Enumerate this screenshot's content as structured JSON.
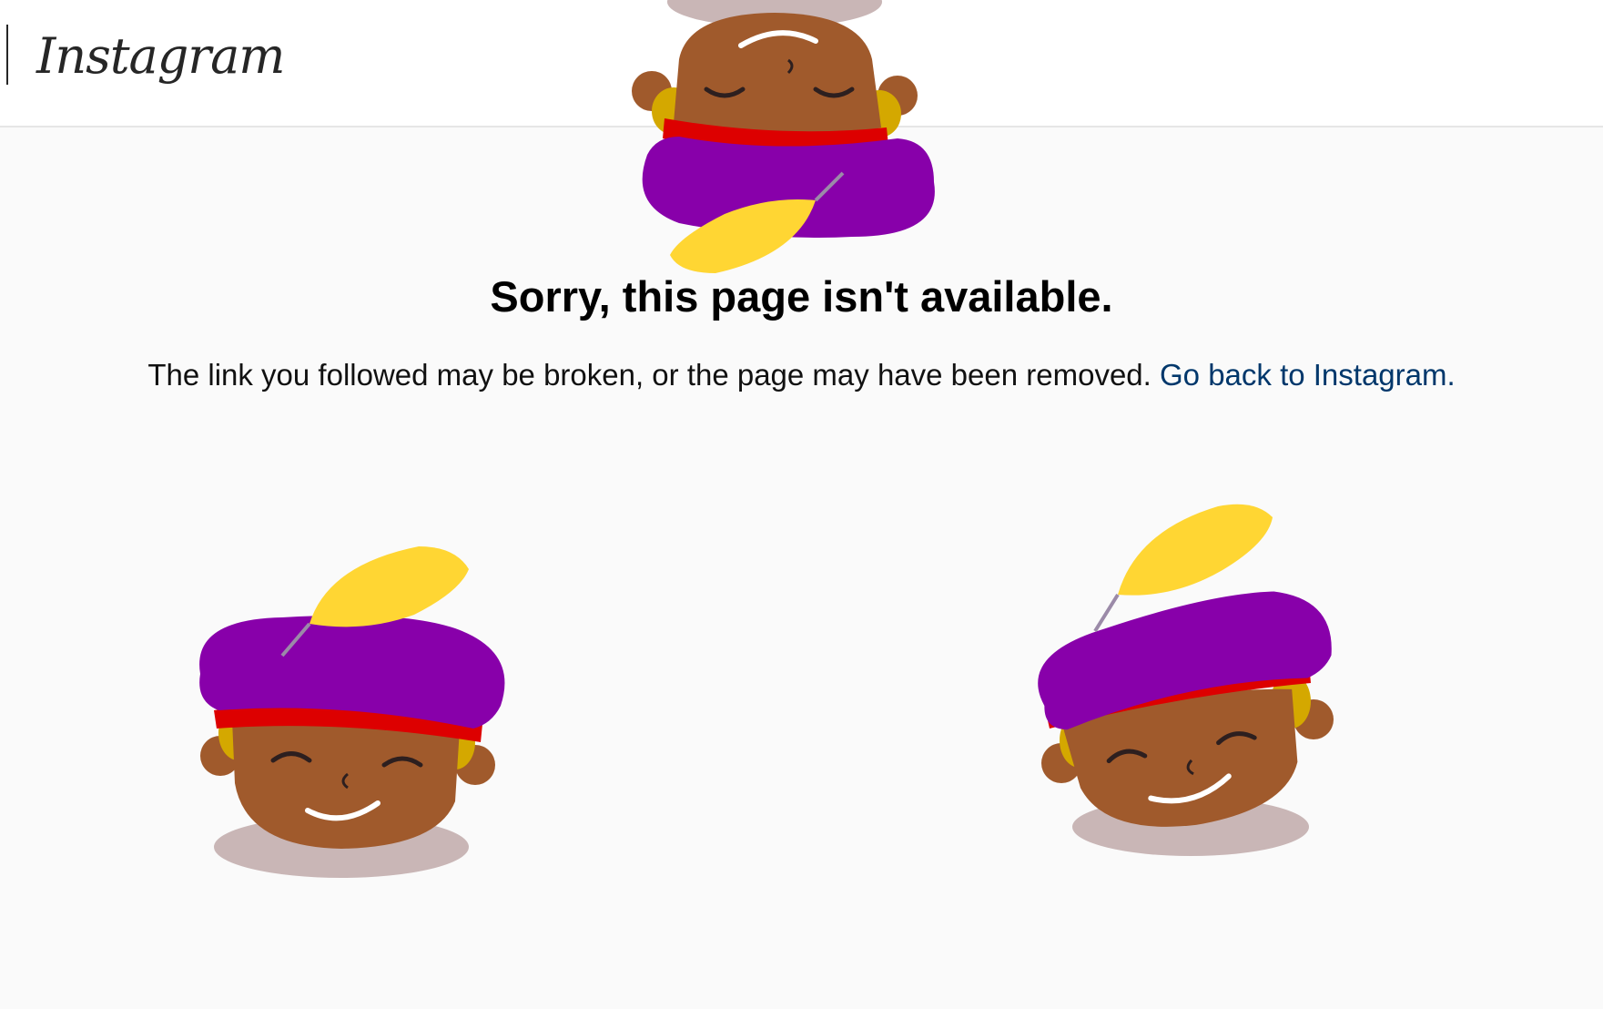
{
  "header": {
    "logo_text": "Instagram"
  },
  "error": {
    "headline": "Sorry, this page isn't available.",
    "message": "The link you followed may be broken, or the page may have been removed.",
    "back_link": "Go back to Instagram."
  },
  "colors": {
    "link": "#00376b",
    "background": "#fafafa",
    "turban": "#8800aa",
    "band": "#dd0000",
    "feather": "#ffd633",
    "skin": "#a05a2c",
    "collar": "#c9b6b6"
  },
  "decorations": [
    "pete-character-upside-down",
    "pete-character-left",
    "pete-character-right"
  ]
}
